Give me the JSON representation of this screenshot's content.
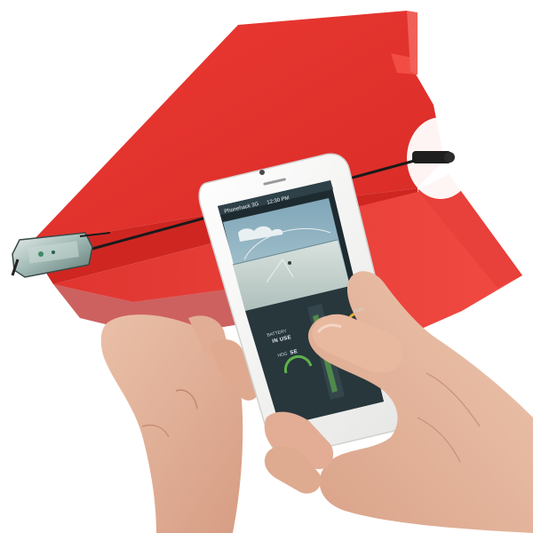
{
  "phone": {
    "status_bar": {
      "carrier": "Phonehack 3G",
      "time": "12:30 PM"
    },
    "hud": {
      "battery_label": "BATTERY",
      "battery_value": "IN USE",
      "hdg_label": "HDG",
      "hdg_value": "SE",
      "throttle_label": "THROT",
      "fuel_label": "FUEL",
      "altitude_label": "ALT"
    }
  },
  "colors": {
    "paper_plane": "#e8322e",
    "paper_plane_shadow": "#c92521",
    "phone_body": "#f4f4f2",
    "screen_sky": "#8fb3c4",
    "screen_ground": "#d8e0dc",
    "skin": "#e3b49c"
  }
}
